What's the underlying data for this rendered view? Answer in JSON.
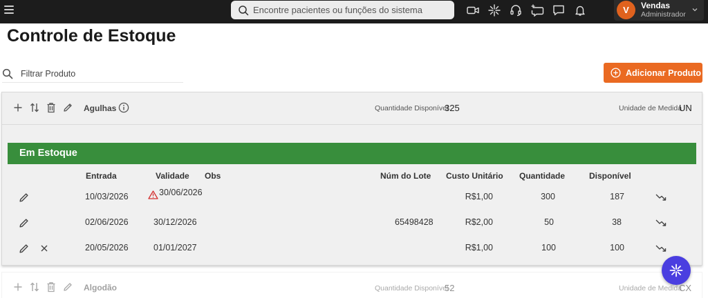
{
  "topbar": {
    "search_placeholder": "Encontre pacientes ou funções do sistema",
    "icons": [
      "video-icon",
      "sparkle-icon",
      "headset-icon",
      "ai-chat-icon",
      "chat-icon",
      "bell-icon"
    ],
    "user": {
      "initial": "V",
      "name": "Vendas",
      "role": "Administrador"
    }
  },
  "page": {
    "title": "Controle de Estoque",
    "filter_placeholder": "Filtrar Produto",
    "add_button_label": "Adicionar Produto"
  },
  "products": [
    {
      "name": "Agulhas",
      "qty_label": "Quantidade Disponível",
      "qty_value": "325",
      "unit_label": "Unidade de Medida",
      "unit_value": "UN",
      "stock_title": "Em Estoque",
      "columns": {
        "entrada": "Entrada",
        "validade": "Validade",
        "obs": "Obs",
        "lote": "Núm do Lote",
        "custo": "Custo Unitário",
        "quantidade": "Quantidade",
        "disponivel": "Disponível"
      },
      "rows": [
        {
          "entrada": "10/03/2026",
          "validade": "30/06/2026",
          "warning": true,
          "obs": "",
          "lote": "",
          "custo": "R$1,00",
          "quantidade": "300",
          "disponivel": "187",
          "deletable": false
        },
        {
          "entrada": "02/06/2026",
          "validade": "30/12/2026",
          "warning": false,
          "obs": "",
          "lote": "65498428",
          "custo": "R$2,00",
          "quantidade": "50",
          "disponivel": "38",
          "deletable": false
        },
        {
          "entrada": "20/05/2026",
          "validade": "01/01/2027",
          "warning": false,
          "obs": "",
          "lote": "",
          "custo": "R$1,00",
          "quantidade": "100",
          "disponivel": "100",
          "deletable": true
        }
      ]
    },
    {
      "name": "Algodão",
      "qty_label": "Quantidade Disponível",
      "qty_value": "52",
      "unit_label": "Unidade de Medida",
      "unit_value": "CX"
    }
  ],
  "colors": {
    "topbar": "#1c1c1c",
    "accent_orange": "#ea6a22",
    "stock_green": "#388e3c",
    "fab_purple": "#4a3ee0",
    "warning_red": "#d32f2f"
  }
}
